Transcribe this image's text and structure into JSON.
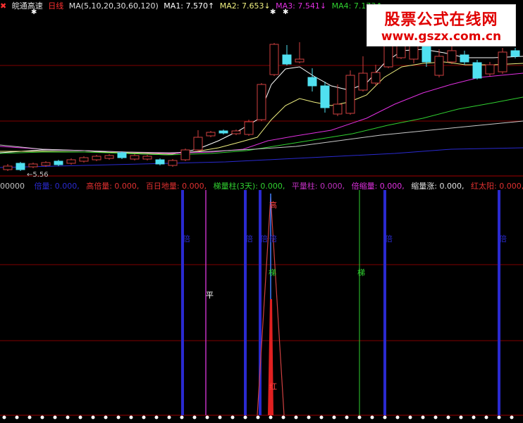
{
  "header": {
    "logo_icon": "x-icon",
    "stock_name": "皖通高速",
    "period": "日线",
    "ma_params": "MA(5,10,20,30,60,120)",
    "ma1": "MA1: 7.570↑",
    "ma2": "MA2: 7.653↓",
    "ma3": "MA3: 7.541↓",
    "ma4": "MA4: 7.173↑"
  },
  "price_label": "5.56",
  "watermark": {
    "title": "股票公式在线网",
    "url": "www.gszx.com.cn"
  },
  "indicator_header": {
    "prefix": "00000",
    "items": [
      {
        "text": "倍量: 0.000,",
        "color": "#2a2ad0"
      },
      {
        "text": "高倍量: 0.000,",
        "color": "#e03030"
      },
      {
        "text": "百日地量: 0.000,",
        "color": "#e03030"
      },
      {
        "text": "梯量柱(3天): 0.000,",
        "color": "#30d030"
      },
      {
        "text": "平量柱: 0.000,",
        "color": "#c030c0"
      },
      {
        "text": "倍缩量: 0.000,",
        "color": "#e030e0"
      },
      {
        "text": "缩量涨: 0.000,",
        "color": "#e0e0e0"
      },
      {
        "text": "红太阳: 0.000,",
        "color": "#e03030"
      }
    ]
  },
  "markers": {
    "bei": "倍",
    "gao": "高",
    "ti": "梯",
    "ping": "平",
    "hong": "红"
  },
  "colors": {
    "up": "#d04040",
    "down": "#50e0f0",
    "ma1": "#ffffff",
    "ma2": "#f0f080",
    "ma3": "#e030e0",
    "ma4": "#30d030",
    "ma5": "#c8c8c8",
    "ma6": "#2a2ad0",
    "bei_line": "#2a2ad0",
    "ping_line": "#c030c0",
    "ti_line": "#30d030",
    "gao_line": "#4080ff",
    "hong_bar": "#e02020",
    "grid": "#800000"
  }
}
